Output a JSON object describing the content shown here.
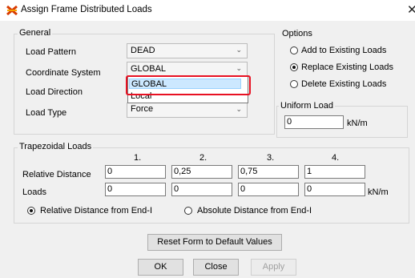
{
  "window": {
    "title": "Assign Frame Distributed Loads",
    "close_glyph": "✕"
  },
  "general": {
    "label": "General",
    "load_pattern": {
      "label": "Load Pattern",
      "value": "DEAD"
    },
    "coordinate_system": {
      "label": "Coordinate System",
      "value": "GLOBAL",
      "options": [
        "GLOBAL",
        "Local"
      ]
    },
    "load_direction": {
      "label": "Load Direction"
    },
    "load_type": {
      "label": "Load Type",
      "value": "Force"
    }
  },
  "options": {
    "label": "Options",
    "items": [
      {
        "label": "Add to Existing Loads",
        "checked": false
      },
      {
        "label": "Replace Existing Loads",
        "checked": true
      },
      {
        "label": "Delete Existing Loads",
        "checked": false
      }
    ]
  },
  "uniform_load": {
    "label": "Uniform Load",
    "value": "0",
    "unit": "kN/m"
  },
  "trapezoidal": {
    "label": "Trapezoidal Loads",
    "columns": [
      "1.",
      "2.",
      "3.",
      "4."
    ],
    "relative_distance": {
      "label": "Relative Distance",
      "values": [
        "0",
        "0,25",
        "0,75",
        "1"
      ]
    },
    "loads": {
      "label": "Loads",
      "values": [
        "0",
        "0",
        "0",
        "0"
      ],
      "unit": "kN/m"
    },
    "distance_mode": [
      {
        "label": "Relative Distance from End-I",
        "checked": true
      },
      {
        "label": "Absolute Distance from End-I",
        "checked": false
      }
    ]
  },
  "buttons": {
    "reset": "Reset Form to Default Values",
    "ok": "OK",
    "close": "Close",
    "apply": "Apply"
  },
  "colors": {
    "highlight": "#e81123",
    "selection": "#cce8ff"
  }
}
